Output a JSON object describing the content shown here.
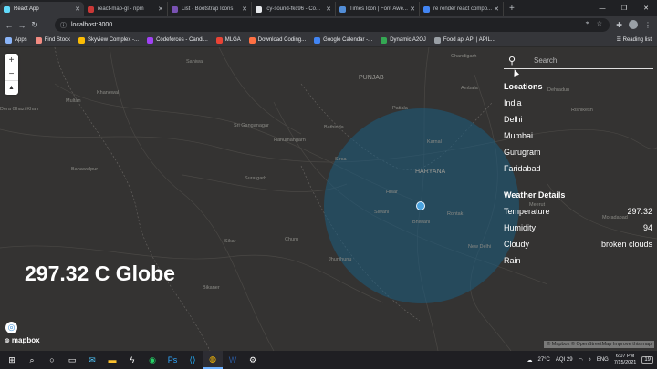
{
  "browser": {
    "tabs": [
      {
        "title": "React App",
        "color": "#61dafb",
        "active": true
      },
      {
        "title": "react-map-gl - npm",
        "color": "#cb3837",
        "active": false
      },
      {
        "title": "List · Bootstrap Icons",
        "color": "#7952b3",
        "active": false
      },
      {
        "title": "icy-sound-fkc96 - Co...",
        "color": "#e8eaed",
        "active": false
      },
      {
        "title": "Times Icon | Font Awe...",
        "color": "#528dd7",
        "active": false
      },
      {
        "title": "re render react compo...",
        "color": "#4285f4",
        "active": false
      }
    ],
    "new_tab": "+",
    "url": "localhost:3000",
    "bookmarks": [
      {
        "label": "Apps",
        "color": "#8ab4f8"
      },
      {
        "label": "Find Stock",
        "color": "#f28b82"
      },
      {
        "label": "Skyview Complex -...",
        "color": "#fbbc04"
      },
      {
        "label": "Codeforces - Candi...",
        "color": "#a142f4"
      },
      {
        "label": "MLGA",
        "color": "#ea4335"
      },
      {
        "label": "Download Coding...",
        "color": "#ff7043"
      },
      {
        "label": "Google Calendar -...",
        "color": "#4285f4"
      },
      {
        "label": "Dynamic A2OJ",
        "color": "#34a853"
      },
      {
        "label": "Food api API | APIL...",
        "color": "#9aa0a6"
      }
    ],
    "reading_list": "Reading list"
  },
  "map": {
    "places": [
      {
        "name": "Chandigarh",
        "cls": ""
      },
      {
        "name": "PUNJAB",
        "cls": "big"
      },
      {
        "name": "Multan",
        "cls": ""
      },
      {
        "name": "Khanewal",
        "cls": ""
      },
      {
        "name": "Sahiwal",
        "cls": ""
      },
      {
        "name": "Dera Ghazi Khan",
        "cls": ""
      },
      {
        "name": "Bathinda",
        "cls": ""
      },
      {
        "name": "Sri Ganganagar",
        "cls": ""
      },
      {
        "name": "Bahawalpur",
        "cls": ""
      },
      {
        "name": "Hanumangarh",
        "cls": ""
      },
      {
        "name": "Suratgarh",
        "cls": ""
      },
      {
        "name": "Sirsa",
        "cls": ""
      },
      {
        "name": "HARYANA",
        "cls": "big"
      },
      {
        "name": "Hisar",
        "cls": ""
      },
      {
        "name": "Siwani",
        "cls": ""
      },
      {
        "name": "Bhiwani",
        "cls": ""
      },
      {
        "name": "Rohtak",
        "cls": ""
      },
      {
        "name": "New Delhi",
        "cls": ""
      },
      {
        "name": "Bikaner",
        "cls": ""
      },
      {
        "name": "Churu",
        "cls": ""
      },
      {
        "name": "Karnal",
        "cls": ""
      },
      {
        "name": "Dehradun",
        "cls": ""
      },
      {
        "name": "Rishikesh",
        "cls": ""
      },
      {
        "name": "Moradabad",
        "cls": ""
      },
      {
        "name": "Meerut",
        "cls": ""
      },
      {
        "name": "Sikar",
        "cls": ""
      },
      {
        "name": "Jhunjhunu",
        "cls": ""
      },
      {
        "name": "Ambala",
        "cls": ""
      },
      {
        "name": "Patiala",
        "cls": ""
      }
    ],
    "overlay_temp": "297.32 C Globe",
    "logo": "mapbox",
    "attribution": "© Mapbox © OpenStreetMap Improve this map",
    "zoom_in": "+",
    "zoom_out": "−",
    "compass": "▲"
  },
  "panel": {
    "search_placeholder": "Search",
    "locations_title": "Locations",
    "locations": [
      "India",
      "Delhi",
      "Mumbai",
      "Gurugram",
      "Faridabad"
    ],
    "details_title": "Weather Details",
    "details": [
      {
        "label": "Temperature",
        "value": "297.32"
      },
      {
        "label": "Humidity",
        "value": "94"
      },
      {
        "label": "Cloudy",
        "value": "broken clouds"
      },
      {
        "label": "Rain",
        "value": ""
      }
    ]
  },
  "taskbar": {
    "weather": "27°C",
    "aqi": "AQI 29",
    "lang": "ENG",
    "time": "6:07 PM",
    "date": "7/15/2021",
    "notif": "19"
  },
  "colors": {
    "map_bg": "#343332",
    "circle_fill": "#1b5c80",
    "marker": "#4aa3df"
  }
}
